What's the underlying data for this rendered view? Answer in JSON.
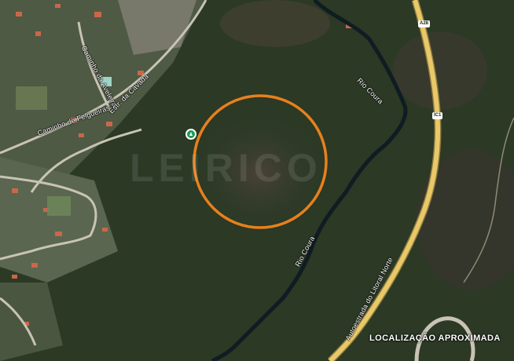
{
  "map": {
    "road_labels": {
      "caminho_aveleira": "Caminho da Aveleira",
      "estr_cavada": "Estr. da Cavada",
      "caminho_felgueiras": "Caminho de Felgueiras",
      "autoestrada": "Autoestrada do Litoral Norte"
    },
    "river_labels": {
      "rio_coura_upper": "Rio Coura",
      "rio_coura_lower": "Rio Coura"
    },
    "shields": {
      "a28": "A28",
      "ic1": "IC1"
    },
    "watermark": "LEIRICO",
    "note": "LOCALIZAÇÃO APROXIMADA",
    "colors": {
      "forest": "#2d3a26",
      "highway": "#e8c868",
      "circle": "#e8801c",
      "pin": "#1e9b4f"
    }
  }
}
